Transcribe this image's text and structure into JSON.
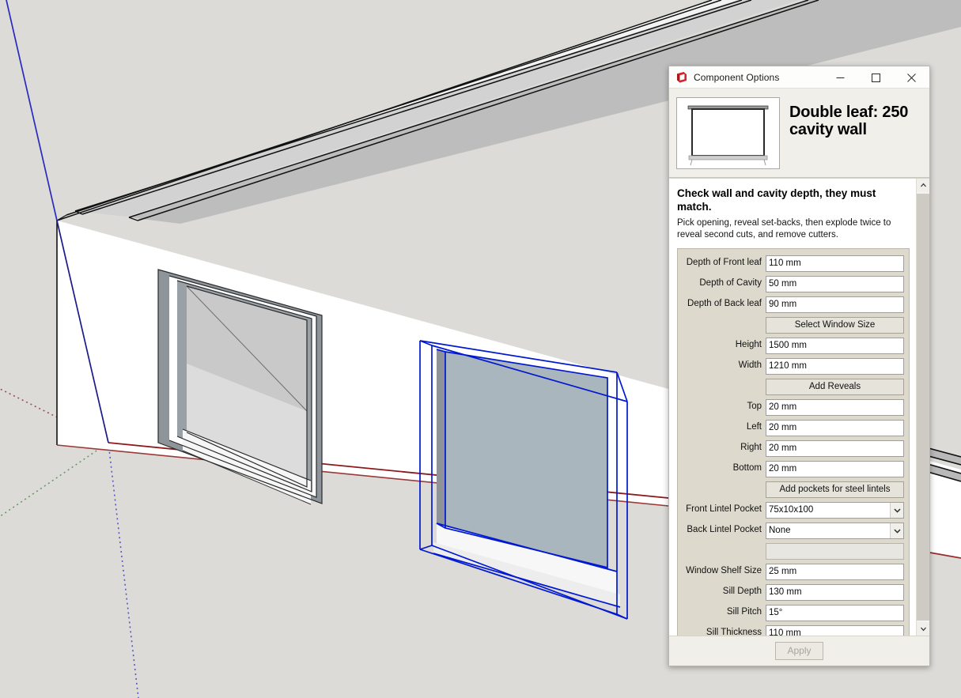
{
  "window": {
    "title": "Component Options",
    "app_icon": "sketchup-logo-icon",
    "minimize_label": "─",
    "maximize_label": "☐",
    "close_label": "✕"
  },
  "header": {
    "component_name": "Double leaf: 250 cavity wall",
    "thumbnail_alt": "window-elevation-thumbnail"
  },
  "instructions": {
    "title": "Check wall and cavity depth, they must match.",
    "subtitle": "Pick opening, reveal set-backs, then explode twice to reveal second cuts, and remove cutters."
  },
  "fields": [
    {
      "type": "text",
      "label": "Depth of Front leaf",
      "value": "110 mm",
      "name": "depth-of-front-leaf"
    },
    {
      "type": "text",
      "label": "Depth of Cavity",
      "value": "50 mm",
      "name": "depth-of-cavity"
    },
    {
      "type": "text",
      "label": "Depth of Back leaf",
      "value": "90 mm",
      "name": "depth-of-back-leaf"
    },
    {
      "type": "button",
      "label": "",
      "value": "Select Window Size",
      "name": "select-window-size-button"
    },
    {
      "type": "text",
      "label": "Height",
      "value": "1500 mm",
      "name": "height"
    },
    {
      "type": "text",
      "label": "Width",
      "value": "1210 mm",
      "name": "width"
    },
    {
      "type": "button",
      "label": "",
      "value": "Add  Reveals",
      "name": "add-reveals-button"
    },
    {
      "type": "text",
      "label": "Top",
      "value": "20 mm",
      "name": "reveal-top"
    },
    {
      "type": "text",
      "label": "Left",
      "value": "20 mm",
      "name": "reveal-left"
    },
    {
      "type": "text",
      "label": "Right",
      "value": "20 mm",
      "name": "reveal-right"
    },
    {
      "type": "text",
      "label": "Bottom",
      "value": "20 mm",
      "name": "reveal-bottom"
    },
    {
      "type": "button",
      "label": "",
      "value": "Add pockets for steel lintels",
      "name": "add-pockets-for-steel-lintels-button"
    },
    {
      "type": "select",
      "label": "Front Lintel Pocket",
      "value": "75x10x100",
      "name": "front-lintel-pocket"
    },
    {
      "type": "select",
      "label": "Back Lintel Pocket",
      "value": "None",
      "name": "back-lintel-pocket"
    },
    {
      "type": "text-disabled",
      "label": "",
      "value": "",
      "name": "spacer-field"
    },
    {
      "type": "text",
      "label": "Window Shelf Size",
      "value": "25 mm",
      "name": "window-shelf-size"
    },
    {
      "type": "text",
      "label": "Sill Depth",
      "value": "130 mm",
      "name": "sill-depth"
    },
    {
      "type": "text",
      "label": "Sill Pitch",
      "value": "15°",
      "name": "sill-pitch"
    },
    {
      "type": "text",
      "label": "Sill Thickness",
      "value": "110 mm",
      "name": "sill-thickness"
    }
  ],
  "footer": {
    "apply_label": "Apply",
    "apply_enabled": false
  },
  "scrollbar": {
    "up_arrow": "⌃",
    "down_arrow": "⌄"
  },
  "viewport": {
    "background_color": "#dcdbd7",
    "wall_face_color": "#ffffff",
    "wall_top_color": "#c9c9c9",
    "selection_color": "#0018d0",
    "glass_color": "#aab6bd",
    "axis_red": "#8b1a1a",
    "axis_green": "#2e7d32",
    "axis_blue": "#1a1a8b"
  }
}
